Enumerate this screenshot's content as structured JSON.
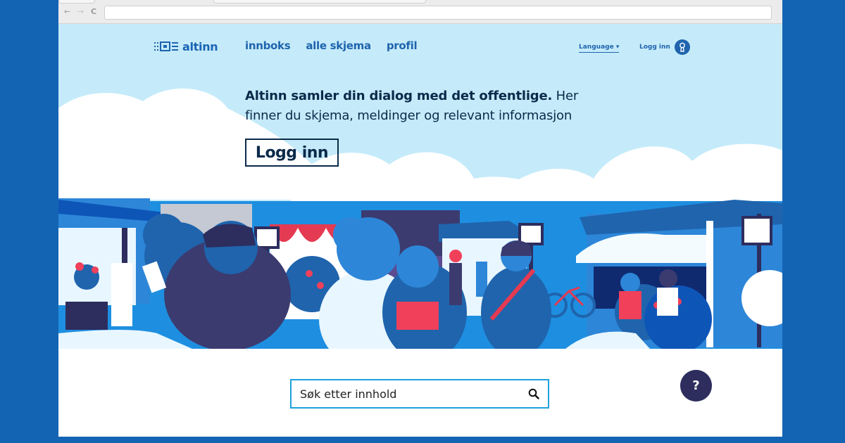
{
  "browser": {
    "nav_back": "←",
    "nav_forward": "→",
    "nav_reload": "C",
    "url": ""
  },
  "header": {
    "logo_text": "altinn",
    "nav": [
      {
        "label": "innboks"
      },
      {
        "label": "alle skjema"
      },
      {
        "label": "profil"
      }
    ],
    "language_label": "Language ▾",
    "login_label": "Logg inn"
  },
  "hero": {
    "lead_bold": "Altinn samler din dialog med det offentlige.",
    "lead_rest": " Her finner du skjema, meldinger og relevant informasjon",
    "button_label": "Logg inn"
  },
  "search": {
    "placeholder": "Søk etter innhold"
  },
  "help": {
    "label": "?"
  },
  "colors": {
    "brand_blue": "#1f64ad",
    "sky": "#c5ebfa",
    "navy": "#0b2a4a",
    "search_border": "#1ea0dc",
    "help_button": "#2d2d5e",
    "background": "#1464b4"
  },
  "icons": {
    "search": "search-icon",
    "user": "keyhole-user-icon",
    "logo": "altinn-logo-icon"
  }
}
